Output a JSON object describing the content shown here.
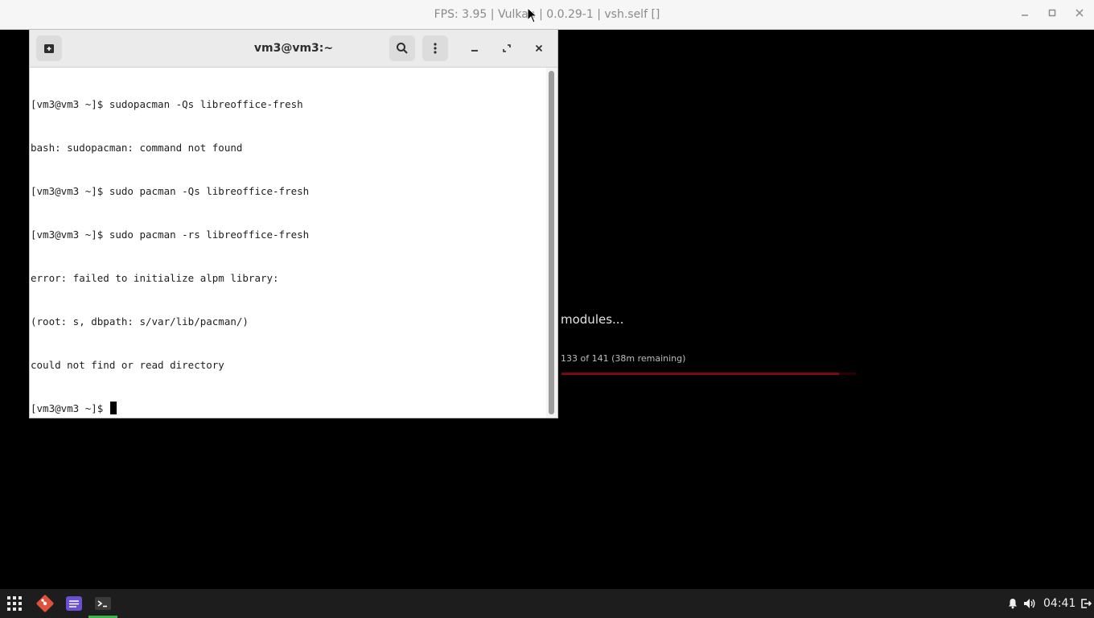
{
  "host_window": {
    "title": "FPS: 3.95 | Vulkan | 0.0.29-1 | vsh.self []",
    "icons": {
      "minimize": "minimize-icon",
      "maximize": "maximize-icon",
      "close": "close-icon"
    }
  },
  "terminal": {
    "title": "vm3@vm3:~",
    "icons": {
      "new_tab": "new-tab-icon",
      "search": "search-icon",
      "menu": "kebab-menu-icon",
      "minimize": "minimize-icon",
      "maximize": "maximize-icon",
      "close": "close-icon"
    },
    "lines": [
      "[vm3@vm3 ~]$ sudopacman -Qs libreoffice-fresh",
      "bash: sudopacman: command not found",
      "[vm3@vm3 ~]$ sudo pacman -Qs libreoffice-fresh",
      "[vm3@vm3 ~]$ sudo pacman -rs libreoffice-fresh",
      "error: failed to initialize alpm library:",
      "(root: s, dbpath: s/var/lib/pacman/)",
      "could not find or read directory"
    ],
    "prompt": "[vm3@vm3 ~]$ "
  },
  "loading": {
    "text": "modules...",
    "progress_text": "133 of 141 (38m remaining)",
    "current": 133,
    "total": 141,
    "bar_color": "#7a0a12"
  },
  "taskbar": {
    "apps": [
      "app-grid-icon",
      "git-icon",
      "text-editor-icon",
      "terminal-icon"
    ],
    "active_app": "terminal-icon",
    "tray_icons": [
      "notification-bell-icon",
      "volume-icon",
      "power-icon"
    ],
    "clock": "04:41",
    "active_indicator_color": "#3bb24a"
  }
}
